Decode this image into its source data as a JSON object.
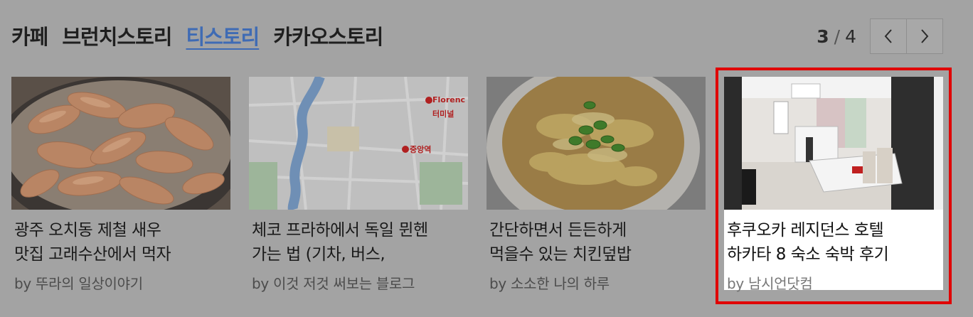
{
  "tabs": [
    {
      "label": "카페",
      "active": false
    },
    {
      "label": "브런치스토리",
      "active": false
    },
    {
      "label": "티스토리",
      "active": true
    },
    {
      "label": "카카오스토리",
      "active": false
    }
  ],
  "pager": {
    "current": "3",
    "separator": "/",
    "total": "4",
    "prev_icon": "chevron-left-icon",
    "next_icon": "chevron-right-icon"
  },
  "cards": [
    {
      "title_line1": "광주 오치동 제철 새우",
      "title_line2": "맛집 고래수산에서 먹자",
      "author": "by 뚜라의 일상이야기",
      "image": "shrimp-photo"
    },
    {
      "title_line1": "체코 프라하에서 독일 뮌헨",
      "title_line2": "가는 법 (기차, 버스,",
      "author": "by 이것 저것 써보는 블로그",
      "image": "map-image",
      "map_labels": [
        "Florenc",
        "터미널",
        "중앙역"
      ]
    },
    {
      "title_line1": "간단하면서 든든하게",
      "title_line2": "먹을수 있는 치킨덮밥",
      "author": "by 소소한 나의 하루",
      "image": "chicken-rice-bowl-photo"
    },
    {
      "title_line1": "후쿠오카 레지던스 호텔",
      "title_line2": "하카타 8 숙소 숙박 후기",
      "author": "by 남시언닷컴",
      "image": "hotel-room-photo",
      "highlighted": true
    }
  ],
  "colors": {
    "overlay_bg": "#a3a3a3",
    "active_tab": "#3f6bb4",
    "highlight_border": "#e00000"
  }
}
